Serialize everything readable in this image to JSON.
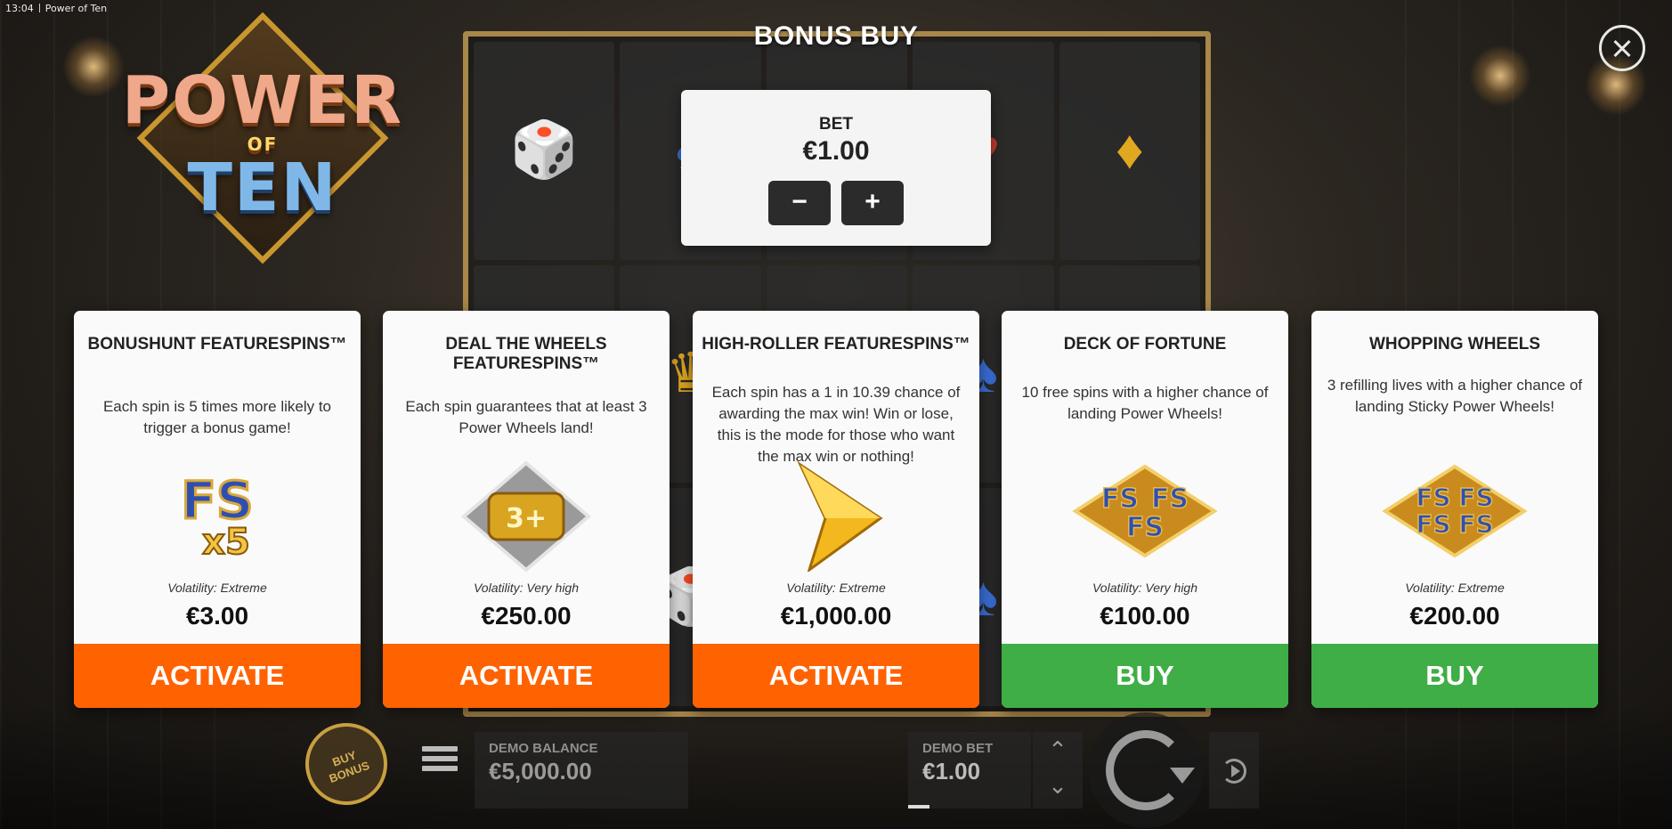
{
  "topbar": {
    "time": "13:04",
    "game_title": "Power of Ten"
  },
  "logo": {
    "line1": "POWER",
    "line2": "OF",
    "line3": "TEN"
  },
  "modal": {
    "title": "BONUS BUY",
    "close_icon": "close-icon"
  },
  "bet": {
    "label": "BET",
    "value": "€1.00",
    "decrease": "−",
    "increase": "+"
  },
  "cards": [
    {
      "title": "BONUSHUNT FEATURESPINS™",
      "description": "Each spin is 5 times more likely to trigger a bonus game!",
      "icon": "fs-x5-icon",
      "icon_text": "FS",
      "icon_sub": "x5",
      "volatility": "Volatility: Extreme",
      "price": "€3.00",
      "button": "ACTIVATE",
      "button_color": "#ff6200"
    },
    {
      "title": "DEAL THE WHEELS FEATURESPINS™",
      "description": "Each spin guarantees that at least 3 Power Wheels land!",
      "icon": "power-wheels-3plus-icon",
      "icon_text": "3+",
      "volatility": "Volatility: Very high",
      "price": "€250.00",
      "button": "ACTIVATE",
      "button_color": "#ff6200"
    },
    {
      "title": "HIGH-ROLLER FEATURESPINS™",
      "description": "Each spin has a 1 in 10.39 chance of awarding the max win! Win or lose, this is the mode for those who want the max win or nothing!",
      "icon": "gold-arrow-icon",
      "volatility": "Volatility: Extreme",
      "price": "€1,000.00",
      "button": "ACTIVATE",
      "button_color": "#ff6200"
    },
    {
      "title": "DECK OF FORTUNE",
      "description": "10 free spins with a higher chance of landing Power Wheels!",
      "icon": "fs-triple-icon",
      "icon_text": "FS",
      "volatility": "Volatility: Very high",
      "price": "€100.00",
      "button": "BUY",
      "button_color": "#3fae46"
    },
    {
      "title": "WHOPPING WHEELS",
      "description": "3 refilling lives with a higher chance of landing Sticky Power Wheels!",
      "icon": "fs-quad-icon",
      "icon_text": "FS",
      "volatility": "Volatility: Extreme",
      "price": "€200.00",
      "button": "BUY",
      "button_color": "#3fae46"
    }
  ],
  "bottom_bar": {
    "buy_bonus_line1": "BUY",
    "buy_bonus_line2": "BONUS",
    "balance_label": "DEMO BALANCE",
    "balance_value": "€5,000.00",
    "bet_label": "DEMO BET",
    "bet_value": "€1.00",
    "menu_icon": "hamburger-menu-icon",
    "spin_icon": "spin-icon",
    "autoplay_icon": "autoplay-icon",
    "bet_up_icon": "chevron-up-icon",
    "bet_down_icon": "chevron-down-icon"
  },
  "reel_symbols": [
    "🎲",
    "♠",
    "●",
    "♥",
    "♦",
    "🂡",
    "♛",
    "♦",
    "♠",
    "●",
    "♣",
    "🎲",
    "♣",
    "♠",
    "♥"
  ],
  "colors": {
    "activate": "#ff6200",
    "buy": "#3fae46",
    "reel_frame": "#a8874a",
    "buy_bonus_gold": "#c8a040"
  }
}
